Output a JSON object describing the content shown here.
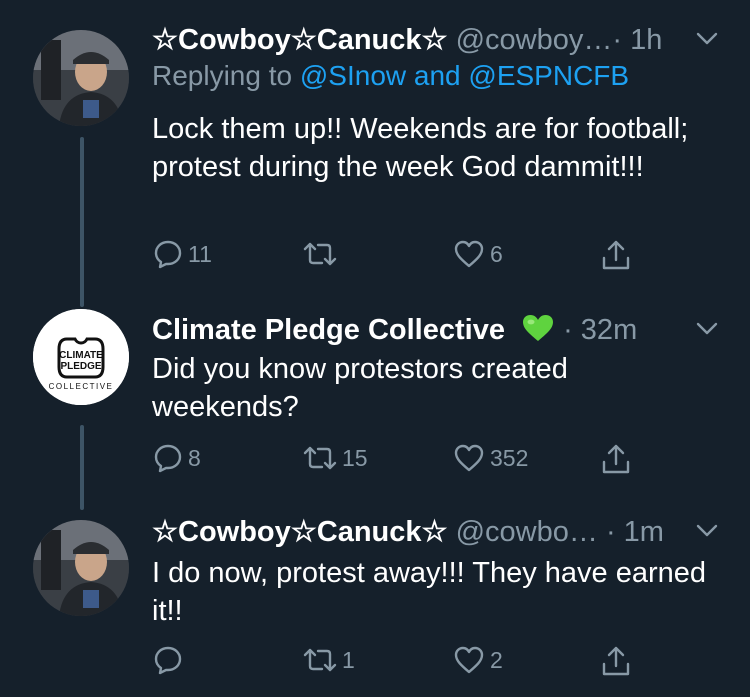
{
  "colors": {
    "background": "#15202b",
    "secondary": "#8899a6",
    "link": "#1da1f2",
    "text": "#ffffff",
    "thread": "#3d5466",
    "heart_emoji": "#5fd33f"
  },
  "tweets": [
    {
      "display_name": "☆Cowboy☆Canuck☆",
      "handle": "@cowboy…",
      "time": "· 1h",
      "reply_prefix": "Replying to",
      "reply_targets": "@SInow and @ESPNCFB",
      "text": "Lock them up!! Weekends are for football; protest during the week God dammit!!!",
      "reply_count": "11",
      "retweet_count": "",
      "like_count": "6",
      "avatar_icon": "user-photo-avatar"
    },
    {
      "display_name": "Climate Pledge Collective",
      "handle": "",
      "time": "· 32m",
      "text": "Did you know protestors created weekends?",
      "reply_count": "8",
      "retweet_count": "15",
      "like_count": "352",
      "verified_emoji": "green-heart-icon",
      "avatar_logo": {
        "line1": "CLIMATE",
        "line2": "PLEDGE",
        "line3": "COLLECTIVE"
      }
    },
    {
      "display_name": "☆Cowboy☆Canuck☆",
      "handle": "@cowbo…",
      "time": "· 1m",
      "text": "I do now, protest away!!! They have earned it!!",
      "reply_count": "",
      "retweet_count": "1",
      "like_count": "2",
      "avatar_icon": "user-photo-avatar"
    }
  ]
}
